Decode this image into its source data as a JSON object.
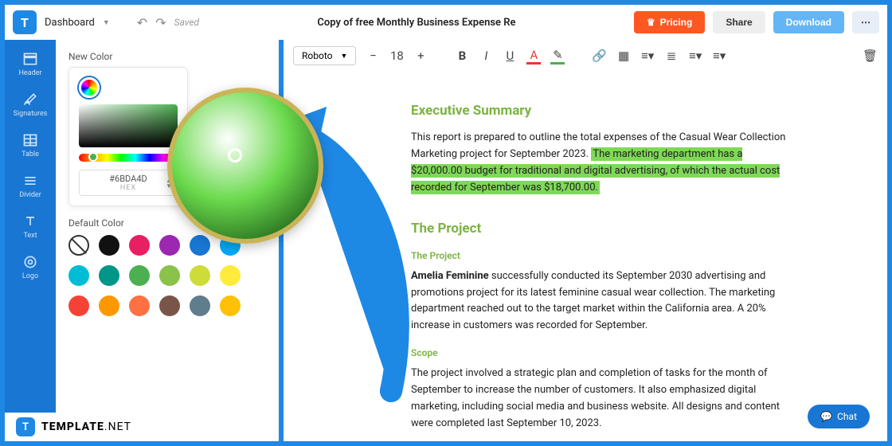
{
  "topbar": {
    "dashboard": "Dashboard",
    "saved": "Saved",
    "title": "Copy of free Monthly Business Expense Re",
    "pricing": "Pricing",
    "share": "Share",
    "download": "Download"
  },
  "sidebar": {
    "items": [
      {
        "label": "Header"
      },
      {
        "label": "Signatures"
      },
      {
        "label": "Table"
      },
      {
        "label": "Divider"
      },
      {
        "label": "Text"
      },
      {
        "label": "Logo"
      }
    ]
  },
  "panel": {
    "newcolor": "New Color",
    "defaultcolor": "Default Color",
    "hex": "#6BDA4D",
    "hexlabel": "HEX"
  },
  "swatches": {
    "row1": [
      "none",
      "#111111",
      "#E91E63",
      "#9C27B0",
      "#1976D2",
      "#03A9F4"
    ],
    "row2": [
      "#00BCD4",
      "#009688",
      "#4CAF50",
      "#8BC34A",
      "#CDDC39",
      "#FFEB3B"
    ],
    "row3": [
      "#F44336",
      "#FF9800",
      "#FF7043",
      "#795548",
      "#607D8B",
      "#FFC107"
    ]
  },
  "toolbar": {
    "font": "Roboto",
    "size": "18"
  },
  "doc": {
    "h1": "Executive Summary",
    "p1a": "This report is prepared to outline the total expenses of the Casual Wear Collection Marketing project for September 2023. ",
    "p1b": "The marketing department has a $20,000.00 budget for traditional and digital advertising, of which the actual cost recorded for September was $18,700.00.",
    "h2": "The Project",
    "sub1": "The Project",
    "p2a": "Amelia Feminine",
    "p2b": " successfully conducted its September 2030 advertising and promotions project for its latest feminine casual wear collection. The marketing department reached out to the target market within the California area. A 20% increase in customers was recorded for September.",
    "sub2": "Scope",
    "p3": "The project involved a strategic plan and completion of tasks for the month of September to increase the number of customers. It also emphasized digital marketing, including social media and business website. All designs and content were completed last September 10, 2023."
  },
  "chat": "Chat",
  "brand": {
    "a": "TEMPLATE",
    "b": ".NET"
  }
}
